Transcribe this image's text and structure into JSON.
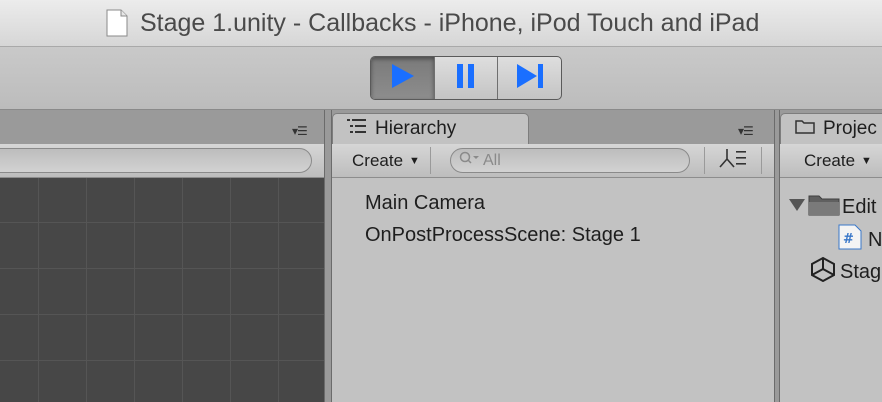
{
  "window": {
    "title": "Stage 1.unity - Callbacks - iPhone, iPod Touch and iPad"
  },
  "toolbar": {
    "play_icon": "play-icon",
    "pause_icon": "pause-icon",
    "step_icon": "step-icon",
    "accent": "#1a6fff"
  },
  "hierarchy": {
    "tab_label": "Hierarchy",
    "create_label": "Create",
    "search_placeholder": "All",
    "items": [
      "Main Camera",
      "OnPostProcessScene: Stage 1"
    ]
  },
  "project": {
    "tab_label": "Projec",
    "create_label": "Create",
    "items": [
      "Edit",
      "N",
      "Stag"
    ]
  }
}
